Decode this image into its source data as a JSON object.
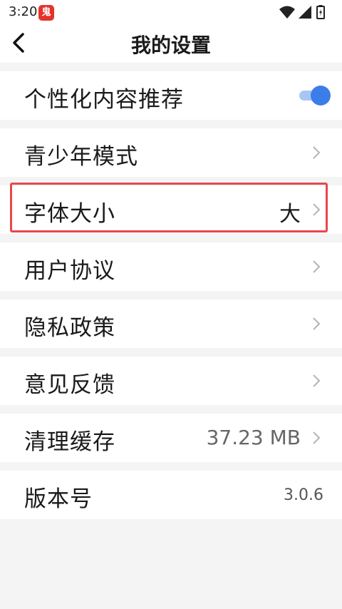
{
  "status_bar": {
    "time": "3:20",
    "app_icon_text": "鬼",
    "icons": [
      "wifi-icon",
      "signal-icon",
      "battery-icon"
    ]
  },
  "header": {
    "title": "我的设置",
    "back_icon": "back-arrow-icon"
  },
  "settings": [
    {
      "label": "个性化内容推荐",
      "type": "toggle",
      "on": true
    },
    {
      "label": "青少年模式",
      "type": "link"
    },
    {
      "label": "字体大小",
      "type": "link",
      "value": "大",
      "highlighted": true
    },
    {
      "label": "用户协议",
      "type": "link"
    },
    {
      "label": "隐私政策",
      "type": "link"
    },
    {
      "label": "意见反馈",
      "type": "link"
    },
    {
      "label": "清理缓存",
      "type": "link",
      "value": "37.23 MB"
    },
    {
      "label": "版本号",
      "type": "static",
      "value": "3.0.6"
    }
  ],
  "colors": {
    "accent": "#3b7de9",
    "toggle_track": "#a8c6f3",
    "highlight_border": "#e8474a",
    "background": "#f4f4f4"
  }
}
